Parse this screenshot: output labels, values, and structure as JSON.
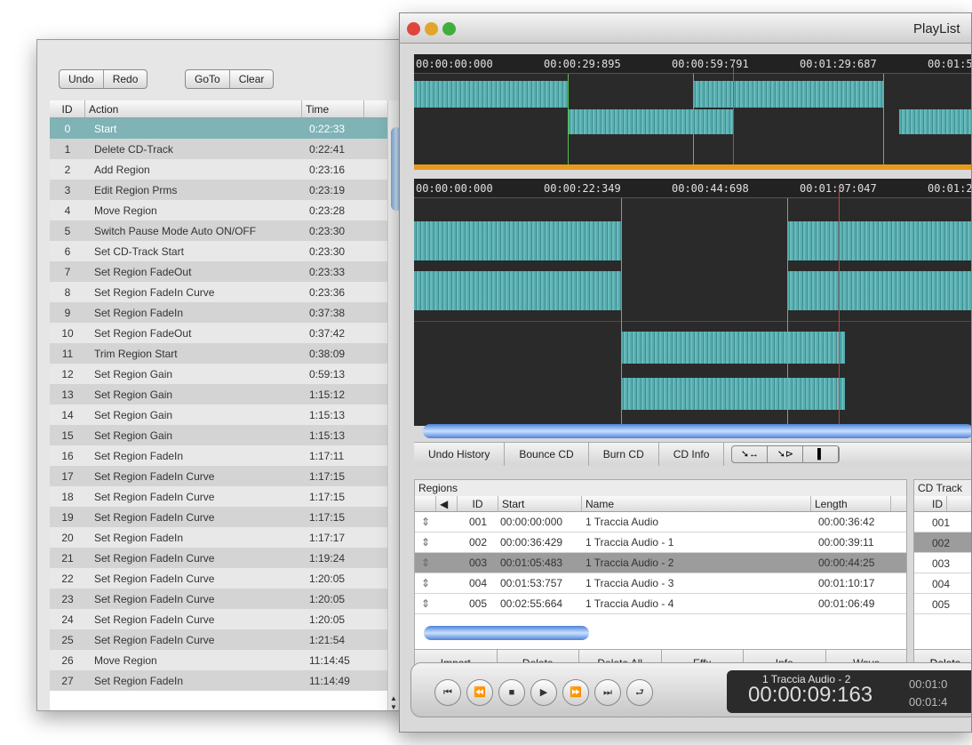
{
  "undo_window": {
    "toolbar": {
      "undo": "Undo",
      "redo": "Redo",
      "goto": "GoTo",
      "clear": "Clear"
    },
    "columns": {
      "id": "ID",
      "action": "Action",
      "time": "Time"
    },
    "rows": [
      {
        "id": "0",
        "action": "Start",
        "time": "0:22:33"
      },
      {
        "id": "1",
        "action": "Delete CD-Track",
        "time": "0:22:41"
      },
      {
        "id": "2",
        "action": "Add Region",
        "time": "0:23:16"
      },
      {
        "id": "3",
        "action": "Edit Region Prms",
        "time": "0:23:19"
      },
      {
        "id": "4",
        "action": "Move Region",
        "time": "0:23:28"
      },
      {
        "id": "5",
        "action": "Switch Pause Mode Auto ON/OFF",
        "time": "0:23:30"
      },
      {
        "id": "6",
        "action": "Set CD-Track Start",
        "time": "0:23:30"
      },
      {
        "id": "7",
        "action": "Set Region FadeOut",
        "time": "0:23:33"
      },
      {
        "id": "8",
        "action": "Set Region FadeIn Curve",
        "time": "0:23:36"
      },
      {
        "id": "9",
        "action": "Set Region FadeIn",
        "time": "0:37:38"
      },
      {
        "id": "10",
        "action": "Set Region FadeOut",
        "time": "0:37:42"
      },
      {
        "id": "11",
        "action": "Trim Region Start",
        "time": "0:38:09"
      },
      {
        "id": "12",
        "action": "Set Region Gain",
        "time": "0:59:13"
      },
      {
        "id": "13",
        "action": "Set Region Gain",
        "time": "1:15:12"
      },
      {
        "id": "14",
        "action": "Set Region Gain",
        "time": "1:15:13"
      },
      {
        "id": "15",
        "action": "Set Region Gain",
        "time": "1:15:13"
      },
      {
        "id": "16",
        "action": "Set Region FadeIn",
        "time": "1:17:11"
      },
      {
        "id": "17",
        "action": "Set Region FadeIn Curve",
        "time": "1:17:15"
      },
      {
        "id": "18",
        "action": "Set Region FadeIn Curve",
        "time": "1:17:15"
      },
      {
        "id": "19",
        "action": "Set Region FadeIn Curve",
        "time": "1:17:15"
      },
      {
        "id": "20",
        "action": "Set Region FadeIn",
        "time": "1:17:17"
      },
      {
        "id": "21",
        "action": "Set Region FadeIn Curve",
        "time": "1:19:24"
      },
      {
        "id": "22",
        "action": "Set Region FadeIn Curve",
        "time": "1:20:05"
      },
      {
        "id": "23",
        "action": "Set Region FadeIn Curve",
        "time": "1:20:05"
      },
      {
        "id": "24",
        "action": "Set Region FadeIn Curve",
        "time": "1:20:05"
      },
      {
        "id": "25",
        "action": "Set Region FadeIn Curve",
        "time": "1:21:54"
      },
      {
        "id": "26",
        "action": "Move Region",
        "time": "11:14:45"
      },
      {
        "id": "27",
        "action": "Set Region FadeIn",
        "time": "11:14:49"
      }
    ],
    "selected_row": "0"
  },
  "playlist": {
    "title": "PlayList",
    "overview_ruler": [
      "00:00:00:000",
      "00:00:29:895",
      "00:00:59:791",
      "00:01:29:687",
      "00:01:5"
    ],
    "detail_ruler": [
      "00:00:00:000",
      "00:00:22:349",
      "00:00:44:698",
      "00:01:07:047",
      "00:01:2"
    ],
    "toolbar": {
      "undo_history": "Undo History",
      "bounce_cd": "Bounce CD",
      "burn_cd": "Burn CD",
      "cd_info": "CD Info"
    },
    "regions": {
      "caption": "Regions",
      "columns": {
        "id": "ID",
        "start": "Start",
        "name": "Name",
        "length": "Length"
      },
      "rows": [
        {
          "id": "001",
          "start": "00:00:00:000",
          "name": "1 Traccia Audio",
          "length": "00:00:36:42"
        },
        {
          "id": "002",
          "start": "00:00:36:429",
          "name": "1 Traccia Audio - 1",
          "length": "00:00:39:11"
        },
        {
          "id": "003",
          "start": "00:01:05:483",
          "name": "1 Traccia Audio - 2",
          "length": "00:00:44:25"
        },
        {
          "id": "004",
          "start": "00:01:53:757",
          "name": "1 Traccia Audio - 3",
          "length": "00:01:10:17"
        },
        {
          "id": "005",
          "start": "00:02:55:664",
          "name": "1 Traccia Audio - 4",
          "length": "00:01:06:49"
        }
      ],
      "selected_row": "003",
      "buttons": {
        "import": "Import",
        "delete": "Delete",
        "delete_all": "Delete All",
        "effx": "Effx",
        "info": "Info",
        "wave": "Wave"
      }
    },
    "cd_tracks": {
      "caption": "CD Track",
      "id_header": "ID",
      "rows": [
        "001",
        "002",
        "003",
        "004",
        "005"
      ],
      "selected_row": "002",
      "delete": "Delete"
    },
    "transport": {
      "track_name": "1 Traccia Audio - 2",
      "time": "00:00:09:163",
      "side_time_1": "00:01:0",
      "side_time_2": "00:01:4"
    }
  }
}
